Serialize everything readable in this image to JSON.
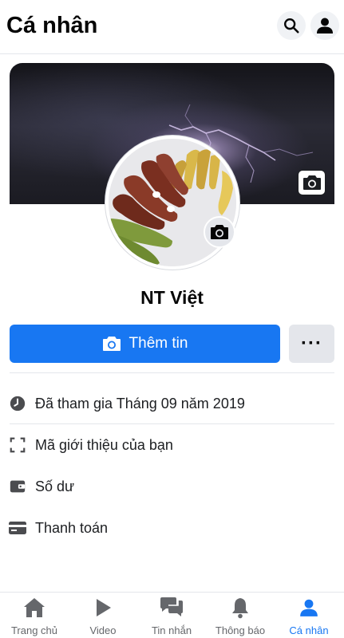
{
  "header": {
    "title": "Cá nhân",
    "search_icon": "search-icon",
    "profile_icon": "person-icon"
  },
  "profile": {
    "name": "NT Việt",
    "cover_camera_icon": "camera-icon",
    "avatar_camera_icon": "camera-icon"
  },
  "actions": {
    "add_story_label": "Thêm tin",
    "more_label": "···"
  },
  "info": [
    {
      "icon": "clock-icon",
      "label": "Đã tham gia Tháng 09 năm 2019"
    },
    {
      "icon": "scan-frame-icon",
      "label": "Mã giới thiệu của bạn"
    },
    {
      "icon": "wallet-icon",
      "label": "Số dư"
    },
    {
      "icon": "credit-card-icon",
      "label": "Thanh toán"
    }
  ],
  "bottom_nav": [
    {
      "icon": "home-icon",
      "label": "Trang chủ",
      "active": false
    },
    {
      "icon": "play-icon",
      "label": "Video",
      "active": false
    },
    {
      "icon": "chat-icon",
      "label": "Tin nhắn",
      "active": false
    },
    {
      "icon": "bell-icon",
      "label": "Thông báo",
      "active": false
    },
    {
      "icon": "person-icon",
      "label": "Cá nhân",
      "active": true
    }
  ],
  "colors": {
    "accent": "#1877f2",
    "inactive": "#65676b"
  }
}
